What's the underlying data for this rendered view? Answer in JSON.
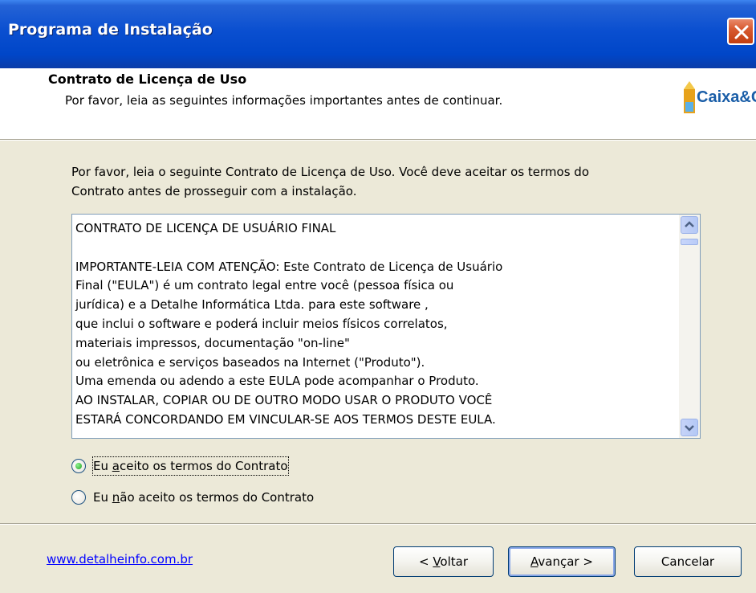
{
  "window": {
    "title": "Programa de Instalação"
  },
  "header": {
    "title": "Contrato de Licença de Uso",
    "subtitle": "Por favor, leia as seguintes informações importantes antes de continuar.",
    "logo_text": "Caixa&Cia"
  },
  "main": {
    "intro_line1": "Por favor, leia o seguinte Contrato de Licença de Uso. Você deve aceitar os termos do",
    "intro_line2": "Contrato antes de prosseguir com a instalação.",
    "license_lines": [
      "CONTRATO DE LICENÇA DE USUÁRIO FINAL",
      "",
      "IMPORTANTE-LEIA COM ATENÇÃO: Este Contrato de Licença de Usuário",
      "Final (\"EULA\") é um contrato legal entre você (pessoa física ou",
      "jurídica) e a Detalhe Informática Ltda. para este software ,",
      "que inclui o software e poderá incluir meios físicos correlatos,",
      "materiais impressos, documentação \"on-line\"",
      "ou eletrônica e serviços baseados na Internet (\"Produto\").",
      "Uma emenda ou adendo a este EULA pode acompanhar o Produto.",
      "AO INSTALAR, COPIAR OU DE OUTRO MODO USAR O PRODUTO VOCÊ",
      "ESTARÁ CONCORDANDO EM VINCULAR-SE AOS TERMOS DESTE EULA."
    ],
    "accept": {
      "pre": "Eu ",
      "mnemonic": "a",
      "post": "ceito os termos do Contrato",
      "selected": true
    },
    "decline": {
      "pre": "Eu ",
      "mnemonic": "n",
      "post": "ão aceito os termos do Contrato",
      "selected": false
    }
  },
  "footer": {
    "link": "www.detalheinfo.com.br",
    "back": {
      "pre": "< ",
      "mnemonic": "V",
      "post": "oltar"
    },
    "next": {
      "mnemonic": "A",
      "post": "vançar >"
    },
    "cancel": "Cancelar"
  },
  "colors": {
    "titlebar": "#0a4fd0",
    "window_bg": "#ece9d8",
    "link": "#0000ff",
    "close_button": "#d85a30"
  }
}
